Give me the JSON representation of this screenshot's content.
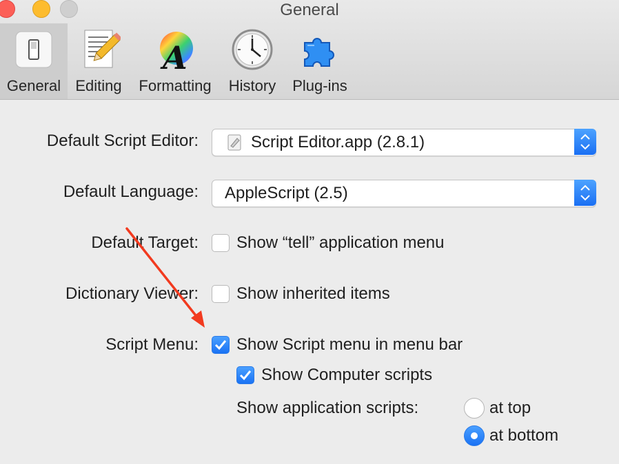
{
  "window": {
    "title": "General"
  },
  "toolbar": {
    "items": [
      {
        "label": "General",
        "icon": "switch-icon",
        "selected": true
      },
      {
        "label": "Editing",
        "icon": "notepad-pencil-icon"
      },
      {
        "label": "Formatting",
        "icon": "color-wheel-font-icon"
      },
      {
        "label": "History",
        "icon": "clock-icon"
      },
      {
        "label": "Plug-ins",
        "icon": "puzzle-piece-icon"
      }
    ]
  },
  "settings": {
    "default_script_editor": {
      "label": "Default Script Editor:",
      "value": "Script Editor.app (2.8.1)"
    },
    "default_language": {
      "label": "Default Language:",
      "value": "AppleScript (2.5)"
    },
    "default_target": {
      "label": "Default Target:",
      "option": "Show “tell” application menu",
      "checked": false
    },
    "dictionary_viewer": {
      "label": "Dictionary Viewer:",
      "option": "Show inherited items",
      "checked": false
    },
    "script_menu": {
      "label": "Script Menu:",
      "option": "Show Script menu in menu bar",
      "checked": true,
      "computer_scripts": {
        "option": "Show Computer scripts",
        "checked": true
      },
      "application_scripts": {
        "label": "Show application scripts:",
        "options": [
          "at top",
          "at bottom"
        ],
        "selected": "at bottom"
      }
    }
  },
  "colors": {
    "accent": "#1a72f4",
    "annotation_arrow": "#f23a1f"
  }
}
